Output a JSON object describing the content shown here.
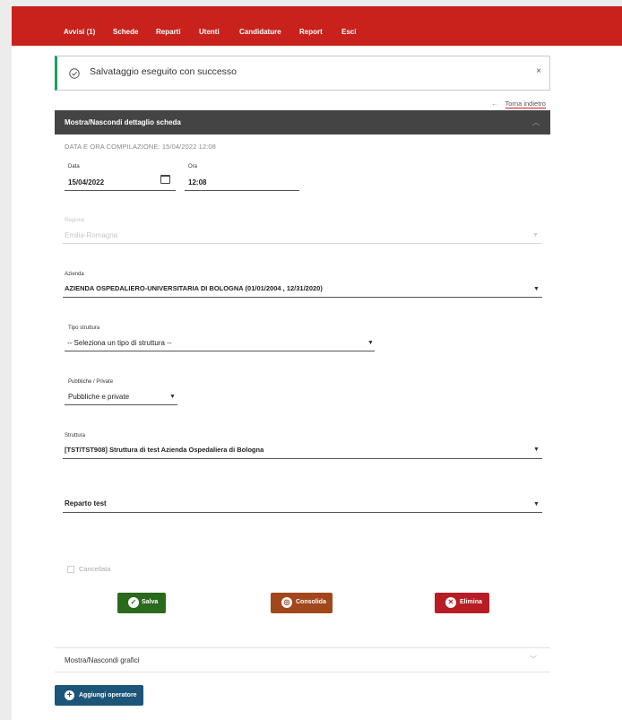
{
  "nav": {
    "items": [
      "Avvisi (1)",
      "Schede",
      "Reparti",
      "Utenti",
      "Candidature",
      "Report",
      "Esci"
    ]
  },
  "alert": {
    "message": "Salvataggio eseguito con successo",
    "close": "×"
  },
  "back_link": "Torna indietro",
  "card": {
    "header": "Mostra/Nascondi dettaglio scheda"
  },
  "form": {
    "meta": "DATA E ORA COMPILAZIONE: 15/04/2022 12:08",
    "data_label": "Data",
    "data_value": "15/04/2022",
    "ora_label": "Ora",
    "ora_value": "12:08",
    "regione_label": "Regione",
    "regione_value": "Emilia-Romagna",
    "azienda_label": "Azienda",
    "azienda_value": "AZIENDA OSPEDALIERO-UNIVERSITARIA DI BOLOGNA (01/01/2004 , 12/31/2020)",
    "tipo_label": "Tipo struttura",
    "tipo_value": "-- Seleziona un tipo di struttura --",
    "pubpriv_label": "Pubbliche / Private",
    "pubpriv_value": "Pubbliche e private",
    "struttura_label": "Struttura",
    "struttura_value": "[TST/TST908] Struttura di test Azienda Ospedaliera di Bologna",
    "reparto_value": "Reparto test",
    "cancellata_label": "Cancellata"
  },
  "buttons": {
    "salva": "Salva",
    "consolida": "Consolida",
    "elimina": "Elimina",
    "aggiungi": "Aggiungi operatore"
  },
  "grafici": {
    "label": "Mostra/Nascondi grafici"
  },
  "colors": {
    "brand_red": "#c9211c",
    "success_green": "#19a15f",
    "save_green": "#2a6a1c",
    "consolida_brown": "#a2461c",
    "elimina_red": "#b81d26",
    "add_blue": "#1c5577"
  }
}
